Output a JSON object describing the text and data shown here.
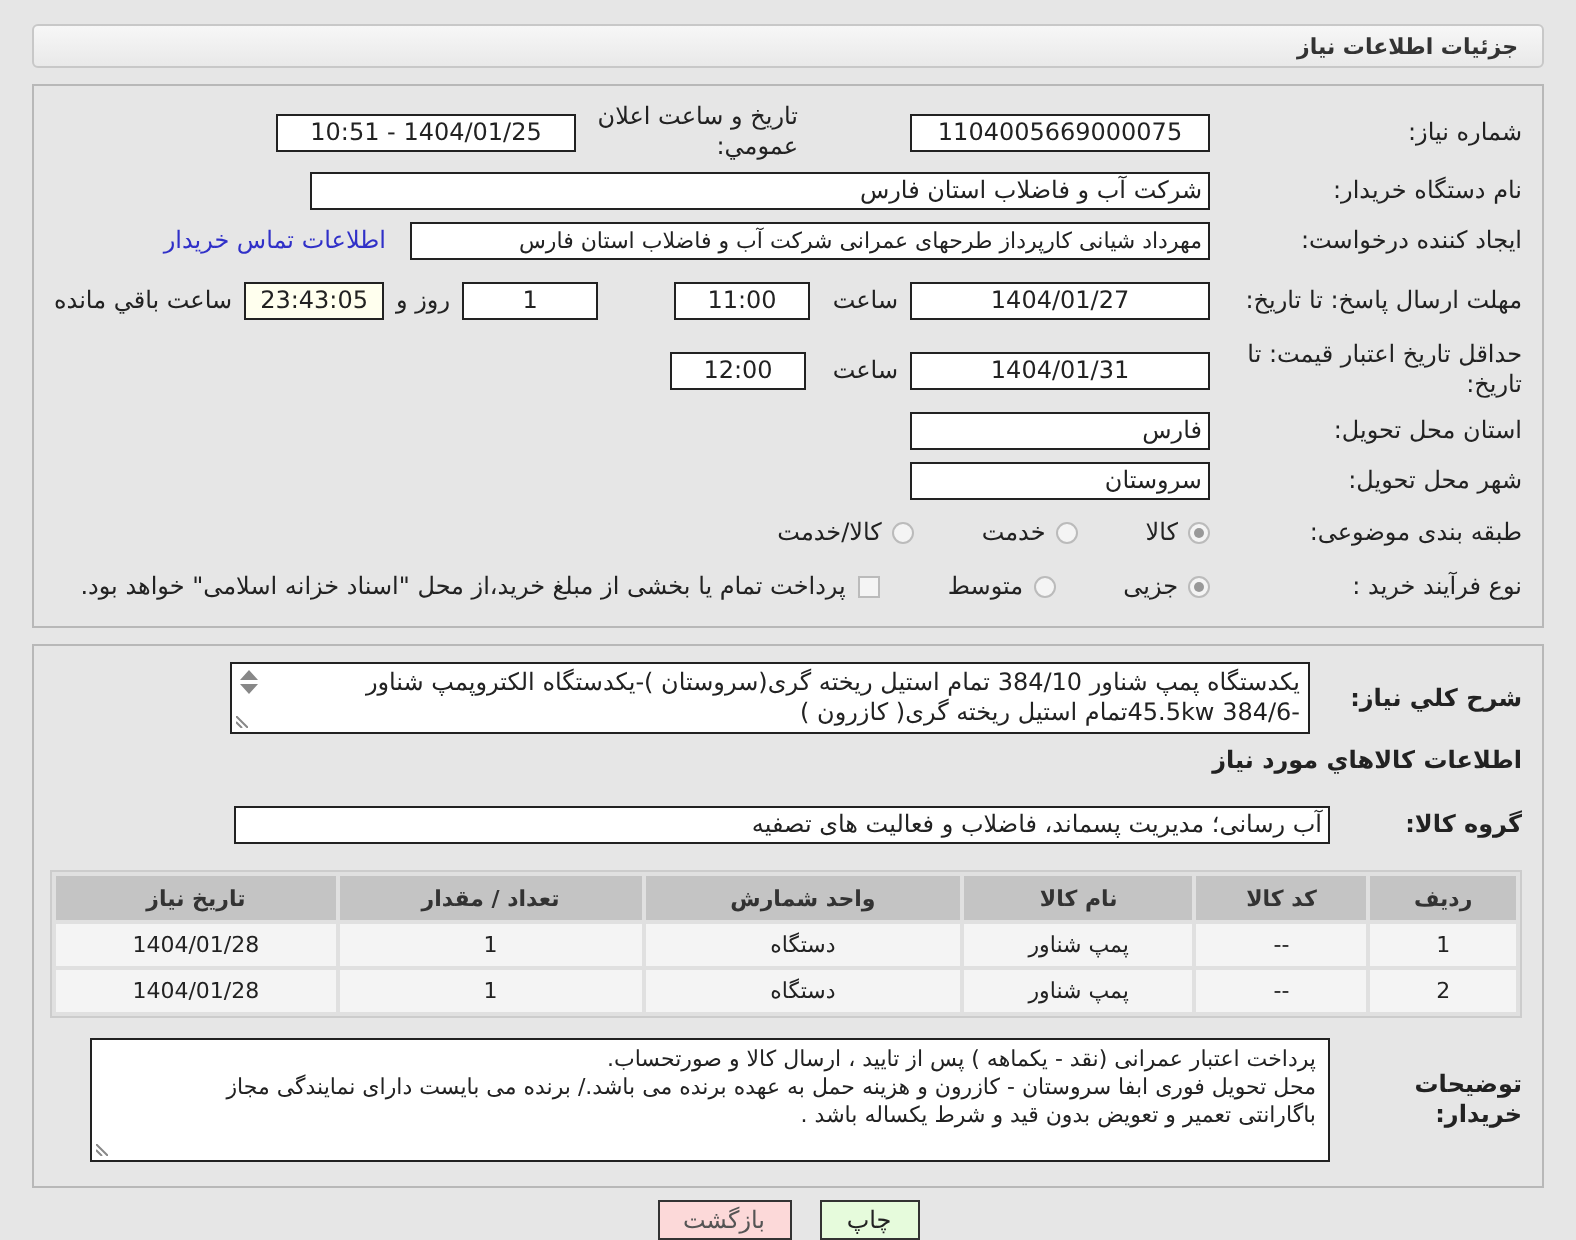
{
  "header": {
    "title": "جزئیات اطلاعات نیاز"
  },
  "need_number": {
    "label": "شماره نیاز:",
    "value": "1104005669000075"
  },
  "announce": {
    "label": "تاریخ و ساعت اعلان عمومي:",
    "value": "1404/01/25 - 10:51"
  },
  "buyer_org": {
    "label": "نام دستگاه خريدار:",
    "value": "شرکت آب و فاضلاب استان فارس"
  },
  "requester": {
    "label": "ایجاد کننده درخواست:",
    "value": "مهرداد شیانی کارپرداز طرحهای عمرانی  شرکت آب و فاضلاب استان فارس",
    "link": "اطلاعات تماس خریدار"
  },
  "reply_deadline": {
    "label": "مهلت ارسال پاسخ: تا تاریخ:",
    "date": "1404/01/27",
    "time_label": "ساعت",
    "time": "11:00",
    "days": "1",
    "days_label": "روز و",
    "remaining": "23:43:05",
    "remaining_label": "ساعت باقي مانده"
  },
  "price_validity": {
    "label": "حداقل تاریخ اعتبار قیمت: تا تاریخ:",
    "date": "1404/01/31",
    "time_label": "ساعت",
    "time": "12:00"
  },
  "province": {
    "label": "استان محل تحویل:",
    "value": "فارس"
  },
  "city": {
    "label": "شهر محل تحویل:",
    "value": "سروستان"
  },
  "category": {
    "label": "طبقه بندی موضوعی:",
    "options": [
      {
        "label": "کالا",
        "selected": true
      },
      {
        "label": "خدمت",
        "selected": false
      },
      {
        "label": "کالا/خدمت",
        "selected": false
      }
    ]
  },
  "process": {
    "label": "نوع فرآیند خرید :",
    "options": [
      {
        "label": "جزیی",
        "selected": true
      },
      {
        "label": "متوسط",
        "selected": false
      }
    ],
    "treasury": {
      "checked": false,
      "text": "پرداخت تمام یا بخشی از مبلغ خرید،از محل \"اسناد خزانه اسلامی\" خواهد بود."
    }
  },
  "description": {
    "label": "شرح کلي نیاز:",
    "value": "یکدستگاه پمپ شناور 384/10 تمام استیل ریخته گری(سروستان )-یکدستگاه الکتروپمپ شناور -45.5kw 384/6تمام استیل ریخته گری( کازرون )"
  },
  "goods_heading": "اطلاعات کالاهاي مورد نیاز",
  "goods_group": {
    "label": "گروه کالا:",
    "value": "آب رسانی؛ مدیریت پسماند، فاضلاب و فعالیت های تصفیه"
  },
  "table": {
    "columns": [
      "ردیف",
      "کد کالا",
      "نام کالا",
      "واحد شمارش",
      "تعداد / مقدار",
      "تاریخ نیاز"
    ],
    "rows": [
      [
        "1",
        "--",
        "پمپ شناور",
        "دستگاه",
        "1",
        "1404/01/28"
      ],
      [
        "2",
        "--",
        "پمپ شناور",
        "دستگاه",
        "1",
        "1404/01/28"
      ]
    ]
  },
  "buyer_notes": {
    "label": "توضیحات خریدار:",
    "lines": [
      "پرداخت اعتبار  عمرانی  (نقد -  یکماهه ) پس از تایید ، ارسال کالا  و صورتحساب.",
      "محل تحویل فوری ابفا سروستان - کازرون   و هزینه حمل به عهده برنده می باشد./ برنده می بایست دارای نمایندگی مجاز",
      "باگارانتی تعمیر و تعویض بدون قید و شرط یکساله باشد ."
    ]
  },
  "buttons": [
    {
      "label": "چاپ",
      "kind": "print"
    },
    {
      "label": "بازگشت",
      "kind": "back"
    }
  ]
}
